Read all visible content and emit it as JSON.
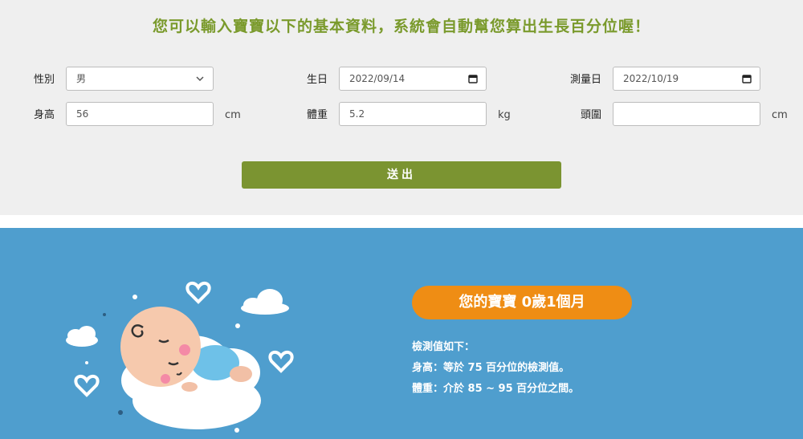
{
  "intro": "您可以輸入寶寶以下的基本資料，系統會自動幫您算出生長百分位喔！",
  "form": {
    "gender_label": "性別",
    "gender_value": "男",
    "birthday_label": "生日",
    "birthday_value": "2022/09/14",
    "measure_label": "測量日",
    "measure_value": "2022/10/19",
    "height_label": "身高",
    "height_value": "56",
    "height_unit": "cm",
    "weight_label": "體重",
    "weight_value": "5.2",
    "weight_unit": "kg",
    "head_label": "頭圍",
    "head_value": "",
    "head_unit": "cm",
    "submit_label": "送出"
  },
  "result": {
    "age_text": "您的寶寶 0歲1個月",
    "heading": "檢測值如下：",
    "height_line": "身高：等於 75 百分位的檢測值。",
    "weight_line": "體重：介於 85 ~ 95 百分位之間。"
  },
  "colors": {
    "accent_green": "#7b9431",
    "title_green": "#7a9a2c",
    "result_blue": "#4f9ece",
    "pill_orange": "#ef8d14"
  },
  "icons": [
    "chevron-down-icon",
    "calendar-icon",
    "baby-illustration",
    "cloud-icon",
    "heart-icon"
  ]
}
